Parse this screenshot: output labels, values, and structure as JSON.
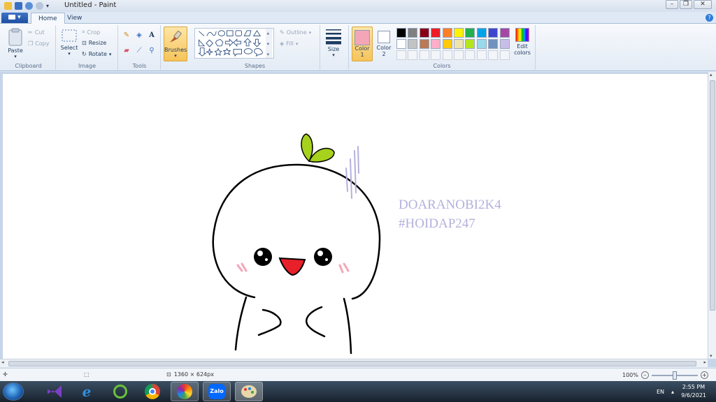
{
  "window": {
    "title": "Untitled - Paint"
  },
  "tabs": {
    "file_label": "▾",
    "home": "Home",
    "view": "View"
  },
  "clipboard": {
    "paste": "Paste",
    "cut": "Cut",
    "copy": "Copy",
    "group": "Clipboard"
  },
  "image": {
    "select": "Select",
    "crop": "Crop",
    "resize": "Resize",
    "rotate": "Rotate",
    "group": "Image"
  },
  "tools": {
    "group": "Tools",
    "text_tool": "A"
  },
  "brushes": {
    "label": "Brushes"
  },
  "shapes": {
    "outline": "Outline",
    "fill": "Fill",
    "group": "Shapes"
  },
  "size": {
    "label": "Size"
  },
  "colors": {
    "color1_label": "Color",
    "color1_num": "1",
    "color2_label": "Color",
    "color2_num": "2",
    "edit_line1": "Edit",
    "edit_line2": "colors",
    "group": "Colors",
    "color1": "#f4a6b8",
    "color2": "#ffffff",
    "palette_row1": [
      "#000000",
      "#7f7f7f",
      "#880015",
      "#ed1c24",
      "#ff7f27",
      "#fff200",
      "#22b14c",
      "#00a2e8",
      "#3f48cc",
      "#a349a4"
    ],
    "palette_row2": [
      "#ffffff",
      "#c3c3c3",
      "#b97a57",
      "#ffaec9",
      "#ffc90e",
      "#efe4b0",
      "#b5e61d",
      "#99d9ea",
      "#7092be",
      "#c8bfe7"
    ]
  },
  "drawing": {
    "text_line1": "DOARANOBI2K4",
    "text_line2": "#HOIDAP247",
    "text_color": "#b4b0dc",
    "leaf_color": "#a6d11c",
    "mouth_color": "#e8202a",
    "blush_color": "#f4a6b8"
  },
  "status": {
    "dimensions": "1360 × 624px",
    "zoom": "100%"
  },
  "taskbar": {
    "lang": "EN",
    "time": "2:55 PM",
    "date": "9/6/2021",
    "zalo": "Zalo"
  }
}
